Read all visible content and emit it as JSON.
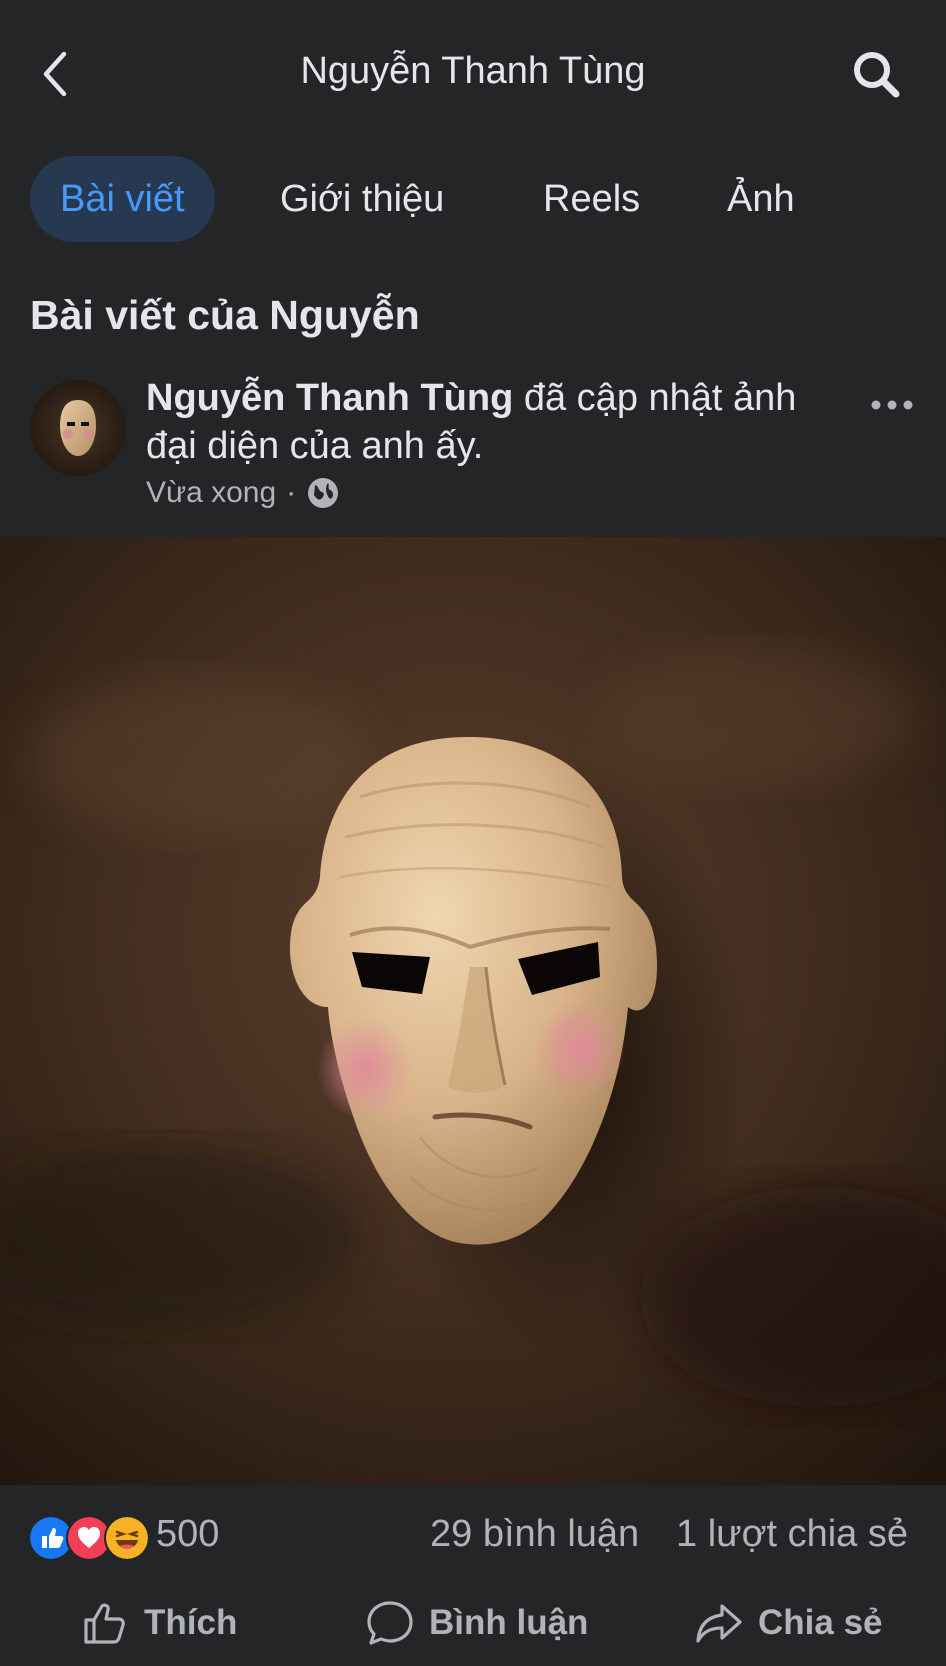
{
  "header": {
    "title": "Nguyễn Thanh Tùng",
    "back_icon": "chevron-left-icon",
    "search_icon": "search-icon"
  },
  "tabs": [
    {
      "label": "Bài viết",
      "active": true
    },
    {
      "label": "Giới thiệu",
      "active": false
    },
    {
      "label": "Reels",
      "active": false
    },
    {
      "label": "Ảnh",
      "active": false
    }
  ],
  "section": {
    "title": "Bài viết của Nguyễn"
  },
  "post": {
    "author": "Nguyễn Thanh Tùng",
    "action_text": " đã cập nhật ảnh đại diện của anh ấy.",
    "time": "Vừa xong",
    "privacy_icon": "globe-icon",
    "more_icon": "more-dots-icon",
    "photo_icon": "wooden-mask-photo"
  },
  "stats": {
    "reaction_icons": [
      "like-icon",
      "love-icon",
      "haha-icon"
    ],
    "reaction_count": "500",
    "comments": "29 bình luận",
    "shares": "1 lượt chia sẻ"
  },
  "actions": {
    "like": "Thích",
    "comment": "Bình luận",
    "share": "Chia sẻ"
  },
  "colors": {
    "background": "#242526",
    "accent": "#4599ff",
    "active_tab_bg": "#263951",
    "text_primary": "#e4e6eb",
    "text_secondary": "#b0b3b8"
  }
}
